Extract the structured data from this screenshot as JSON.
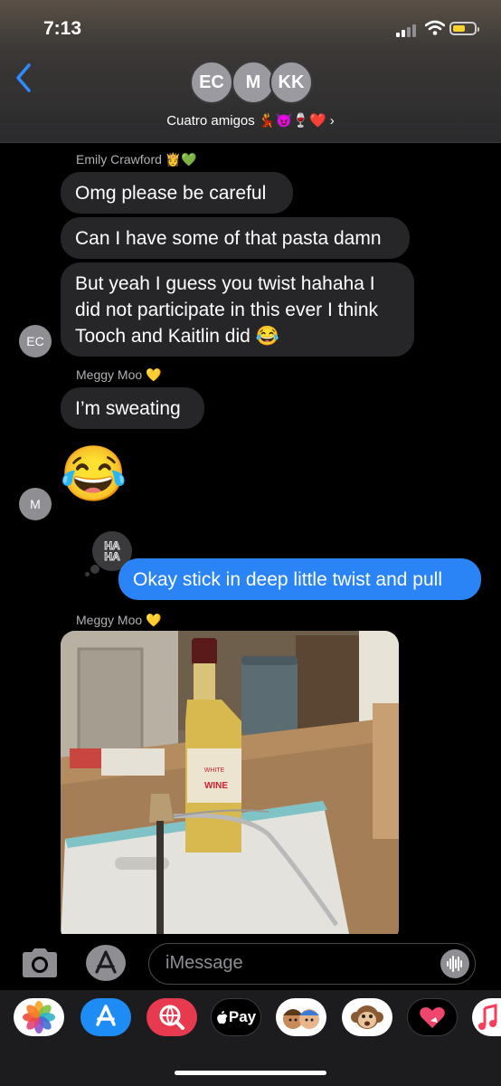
{
  "status": {
    "time": "7:13"
  },
  "header": {
    "avatars": [
      "EC",
      "M",
      "KK"
    ],
    "group_name": "Cuatro amigos 💃😈🍷❤️ ›"
  },
  "messages": [
    {
      "sender": "Emily Crawford 👸💚"
    },
    {
      "text": "Omg please be careful"
    },
    {
      "text": "Can I have some of that pasta damn"
    },
    {
      "text_lines": [
        "But yeah I guess you twist hahaha I",
        "did not participate in this ever I think",
        "Tooch and Kaitlin did 😂"
      ]
    },
    {
      "avatar": "EC"
    },
    {
      "sender": "Meggy Moo 💛"
    },
    {
      "text": "I’m sweating"
    },
    {
      "emoji": "😂"
    },
    {
      "avatar": "M"
    },
    {
      "tapback": [
        "HA",
        "HA"
      ]
    },
    {
      "text": "Okay stick in deep little twist and pull",
      "outgoing": true
    },
    {
      "sender": "Meggy Moo 💛"
    }
  ],
  "photo": {
    "label_line1": "WHITE",
    "label_line2": "WINE"
  },
  "composer": {
    "placeholder": "iMessage"
  },
  "apps": [
    "photos-app",
    "app-store-app",
    "images-search-app",
    "apple-pay-app",
    "memoji-app",
    "animoji-app",
    "digital-touch-app",
    "music-app"
  ],
  "apple_pay_label": "Pay",
  "colors": {
    "outgoing": "#2b84f5",
    "incoming": "#262629",
    "accent": "#2d8cff"
  }
}
